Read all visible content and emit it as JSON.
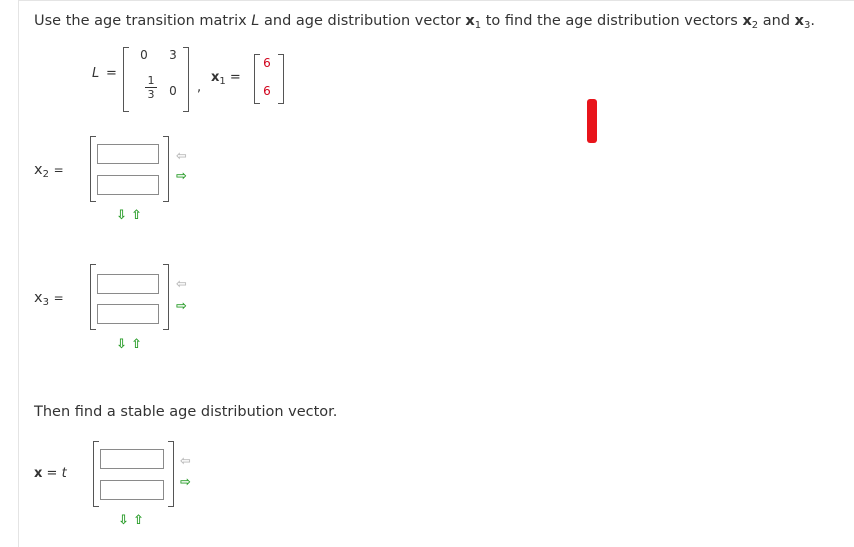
{
  "question": {
    "prefix": "Use the age transition matrix ",
    "L": "L",
    "mid": " and age distribution vector ",
    "x": "x",
    "x1_sub": "1",
    "mid2": " to find the age distribution vectors ",
    "x2_sub": "2",
    "and": " and ",
    "x3_sub": "3",
    "end": "."
  },
  "matrix_L": {
    "label": "L",
    "eq": "=",
    "r1c1": "0",
    "r1c2": "3",
    "r2c1_num": "1",
    "r2c1_den": "3",
    "r2c2": "0",
    "comma": ","
  },
  "vector_x1": {
    "label": "x",
    "sub": "1",
    "eq": "=",
    "v1": "6",
    "v2": "6",
    "color": "#d0021b"
  },
  "answers": {
    "x2": {
      "label": "x",
      "sub": "2",
      "eq": "=",
      "top_value": "",
      "bottom_value": ""
    },
    "x3": {
      "label": "x",
      "sub": "3",
      "eq": "=",
      "top_value": "",
      "bottom_value": ""
    },
    "stable": {
      "label": "x",
      "eq": "=",
      "t": "t",
      "top_value": "",
      "bottom_value": ""
    }
  },
  "stable_prompt": "Then find a stable age distribution vector.",
  "icons": {
    "left": "⇦",
    "right": "⇨",
    "down": "⇩",
    "up": "⇧"
  },
  "colors": {
    "arrow_active": "#2a9d2a",
    "arrow_inactive": "#bbbbbb",
    "mark": "#e8141b"
  }
}
